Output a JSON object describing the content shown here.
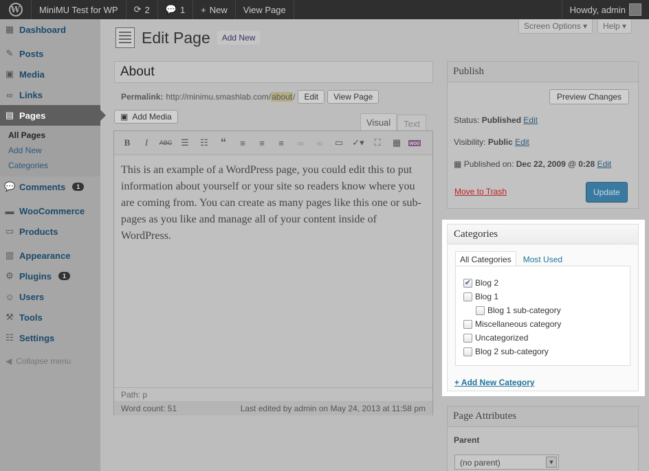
{
  "adminbar": {
    "site": "MiniMU Test for WP",
    "updates": "2",
    "comments": "1",
    "new": "New",
    "view": "View Page",
    "howdy": "Howdy, admin"
  },
  "icons": {
    "wp": "wordpress-logo-icon",
    "updates": "refresh-icon",
    "comments": "comment-bubble-icon",
    "new": "plus-icon"
  },
  "menu": {
    "dashboard": "Dashboard",
    "posts": "Posts",
    "media": "Media",
    "links": "Links",
    "pages": "Pages",
    "pages_sub": [
      "All Pages",
      "Add New",
      "Categories"
    ],
    "comments": "Comments",
    "comments_count": "1",
    "woocommerce": "WooCommerce",
    "products": "Products",
    "appearance": "Appearance",
    "plugins": "Plugins",
    "plugins_count": "1",
    "users": "Users",
    "tools": "Tools",
    "settings": "Settings",
    "collapse": "Collapse menu"
  },
  "header": {
    "title": "Edit Page",
    "add_new": "Add New",
    "screen_options": "Screen Options",
    "help": "Help"
  },
  "post": {
    "title": "About",
    "permalink_label": "Permalink:",
    "permalink_base": "http://minimu.smashlab.com/",
    "slug": "about",
    "permalink_end": "/",
    "edit": "Edit",
    "view_page": "View Page"
  },
  "editor": {
    "add_media": "Add Media",
    "tab_visual": "Visual",
    "tab_text": "Text",
    "content": "This is an example of a WordPress page, you could edit this to put information about yourself or your site so readers know where you are coming from. You can create as many pages like this one or sub-pages as you like and manage all of your content inside of WordPress.",
    "path": "Path: p",
    "word_count": "Word count: 51",
    "last_edited": "Last edited by admin on May 24, 2013 at 11:58 pm"
  },
  "publish": {
    "title": "Publish",
    "preview": "Preview Changes",
    "status_label": "Status:",
    "status": "Published",
    "visibility_label": "Visibility:",
    "visibility": "Public",
    "published_label": "Published on:",
    "published_date": "Dec 22, 2009 @ 0:28",
    "edit": "Edit",
    "trash": "Move to Trash",
    "update": "Update"
  },
  "categories": {
    "title": "Categories",
    "tab_all": "All Categories",
    "tab_used": "Most Used",
    "items": [
      {
        "label": "Blog 2",
        "checked": true
      },
      {
        "label": "Blog 1",
        "checked": false
      },
      {
        "label": "Blog 1 sub-category",
        "checked": false
      },
      {
        "label": "Miscellaneous category",
        "checked": false
      },
      {
        "label": "Uncategorized",
        "checked": false
      },
      {
        "label": "Blog 2 sub-category",
        "checked": false
      }
    ],
    "add_new": "+ Add New Category"
  },
  "attributes": {
    "title": "Page Attributes",
    "parent_label": "Parent",
    "parent_value": "(no parent)"
  }
}
